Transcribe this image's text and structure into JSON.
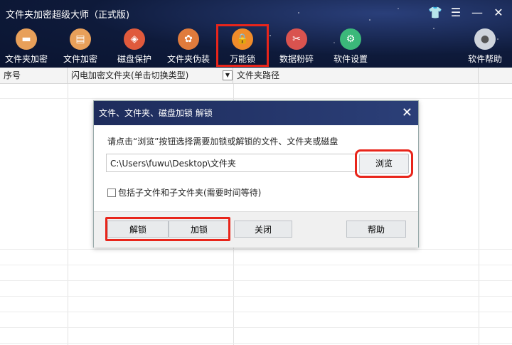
{
  "app": {
    "title": "文件夹加密超级大师（正式版)"
  },
  "window_controls": [
    "shirt-icon",
    "menu-icon",
    "minimize-icon",
    "close-icon"
  ],
  "toolbar": [
    {
      "label": "文件夹加密",
      "icon": "folder-icon",
      "color": "#e8a05a"
    },
    {
      "label": "文件加密",
      "icon": "document-icon",
      "color": "#e8a05a"
    },
    {
      "label": "磁盘保护",
      "icon": "shield-icon",
      "color": "#e05a3c"
    },
    {
      "label": "文件夹伪装",
      "icon": "palette-icon",
      "color": "#e07b3c"
    },
    {
      "label": "万能锁",
      "icon": "lock-icon",
      "color": "#f08c2a"
    },
    {
      "label": "数据粉碎",
      "icon": "scissors-icon",
      "color": "#d9534f"
    },
    {
      "label": "软件设置",
      "icon": "gear-icon",
      "color": "#3bb87a"
    },
    {
      "label": "软件帮助",
      "icon": "user-icon",
      "color": "#cfd4dc"
    }
  ],
  "grid": {
    "headers": [
      "序号",
      "闪电加密文件夹(单击切换类型)",
      "文件夹路径"
    ]
  },
  "dialog": {
    "title": "文件、文件夹、磁盘加锁 解锁",
    "hint": "请点击“浏览”按钮选择需要加锁或解锁的文件、文件夹或磁盘",
    "path_value": "C:\\Users\\fuwu\\Desktop\\文件夹",
    "browse_label": "浏览",
    "checkbox_label": "包括子文件和子文件夹(需要时间等待)",
    "buttons": {
      "unlock": "解锁",
      "lock": "加锁",
      "close": "关闭",
      "help": "帮助"
    }
  },
  "colors": {
    "highlight": "#e8251b",
    "title_bg": "#0e1a3a"
  }
}
